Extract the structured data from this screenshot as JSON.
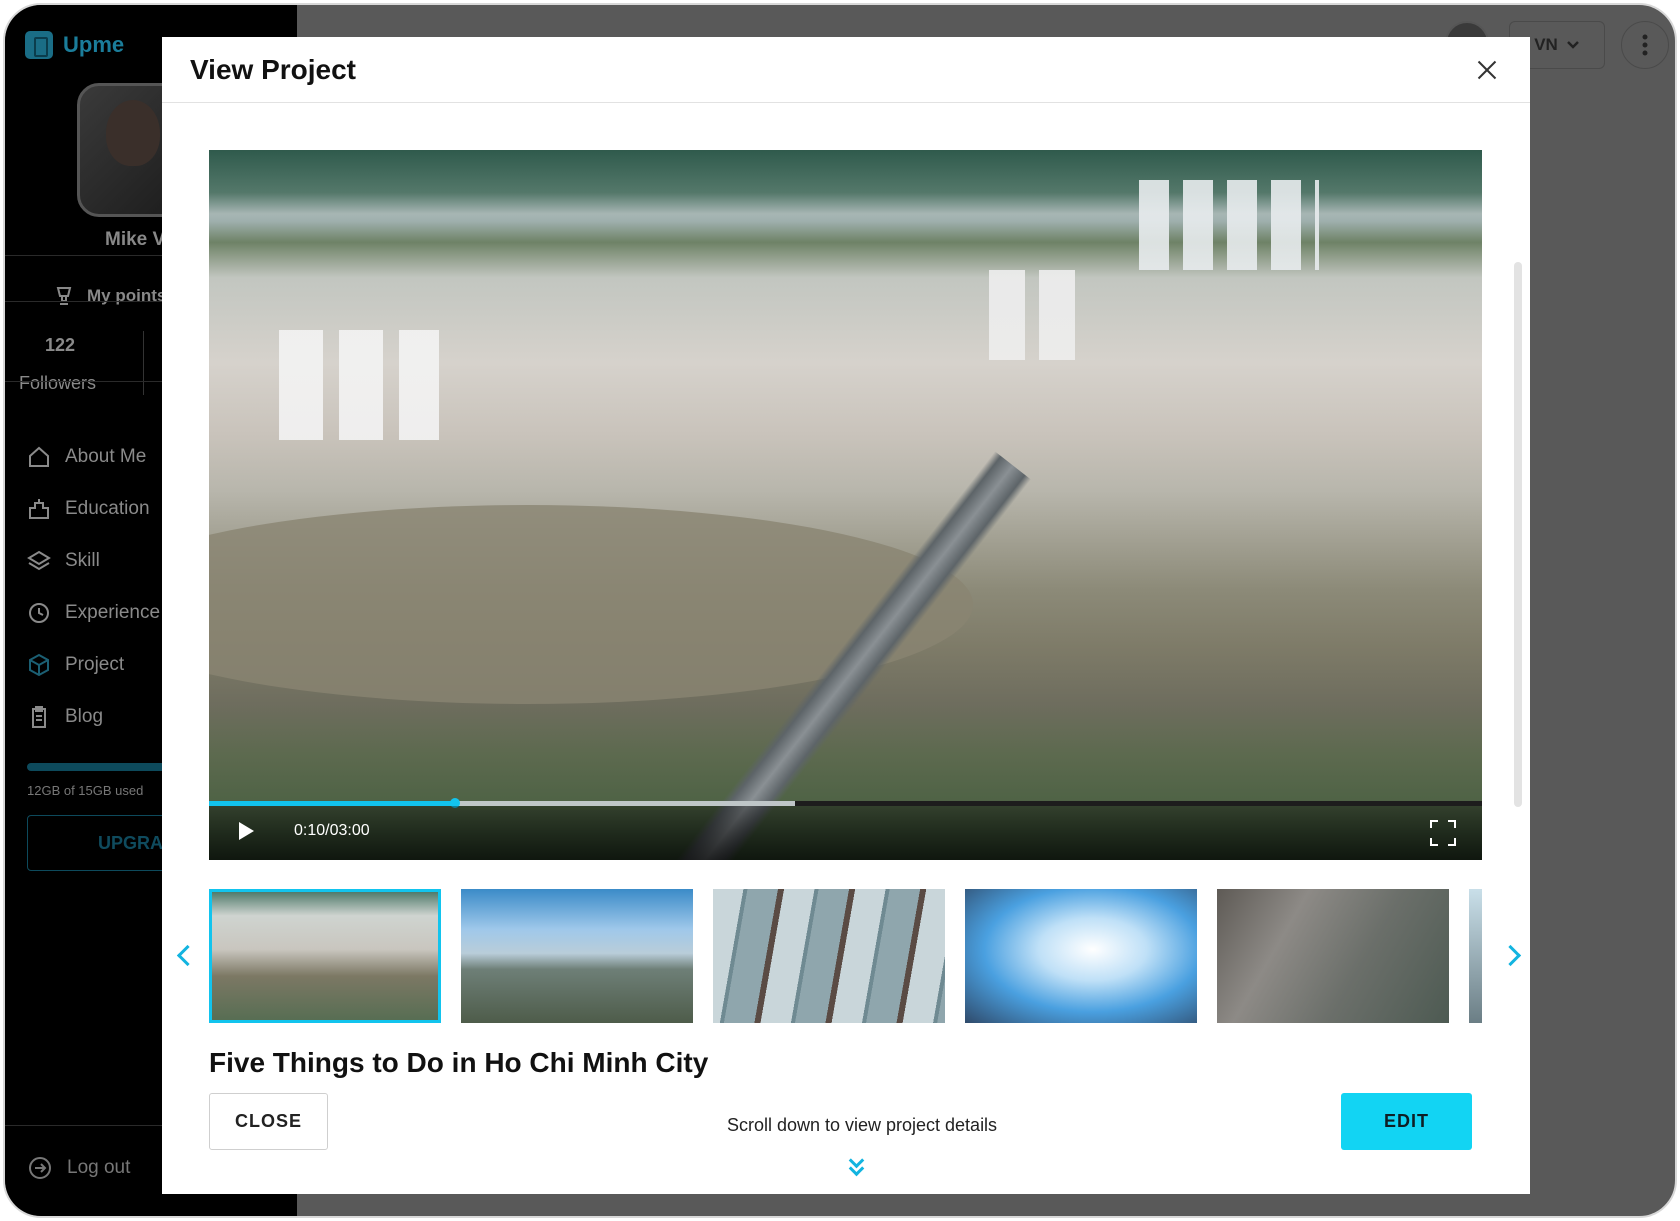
{
  "app": {
    "name": "Upme"
  },
  "sidebar": {
    "user_name": "Mike V",
    "points_label": "My points",
    "followers_count": "122",
    "followers_label": "Followers",
    "items": [
      {
        "label": "About Me",
        "icon": "home-icon"
      },
      {
        "label": "Education",
        "icon": "education-icon"
      },
      {
        "label": "Skill",
        "icon": "layers-icon"
      },
      {
        "label": "Experience",
        "icon": "clock-icon"
      },
      {
        "label": "Project",
        "icon": "cube-icon"
      },
      {
        "label": "Blog",
        "icon": "clipboard-icon"
      }
    ],
    "storage_text": "12GB of 15GB used",
    "storage_fraction": 0.8,
    "upgrade_label": "UPGRADE",
    "logout_label": "Log out"
  },
  "topbar": {
    "language": "VN"
  },
  "modal": {
    "title": "View Project",
    "video": {
      "current_time": "0:10",
      "duration": "03:00",
      "time_display": "0:10/03:00",
      "played_fraction": 0.193,
      "buffered_fraction": 0.46
    },
    "thumbnails": [
      {
        "name": "aerial-bridge-city",
        "active": true
      },
      {
        "name": "skyline-river",
        "active": false
      },
      {
        "name": "glass-facade",
        "active": false
      },
      {
        "name": "skyscrapers-sky",
        "active": false
      },
      {
        "name": "street-traffic",
        "active": false
      },
      {
        "name": "partial-thumbnail",
        "active": false
      }
    ],
    "project_title": "Five Things to Do in Ho Chi Minh City",
    "close_label": "CLOSE",
    "edit_label": "EDIT",
    "scroll_hint": "Scroll down to view project details"
  },
  "colors": {
    "accent": "#12d4f3",
    "progress": "#12c4ee",
    "overlay": "#595959"
  }
}
